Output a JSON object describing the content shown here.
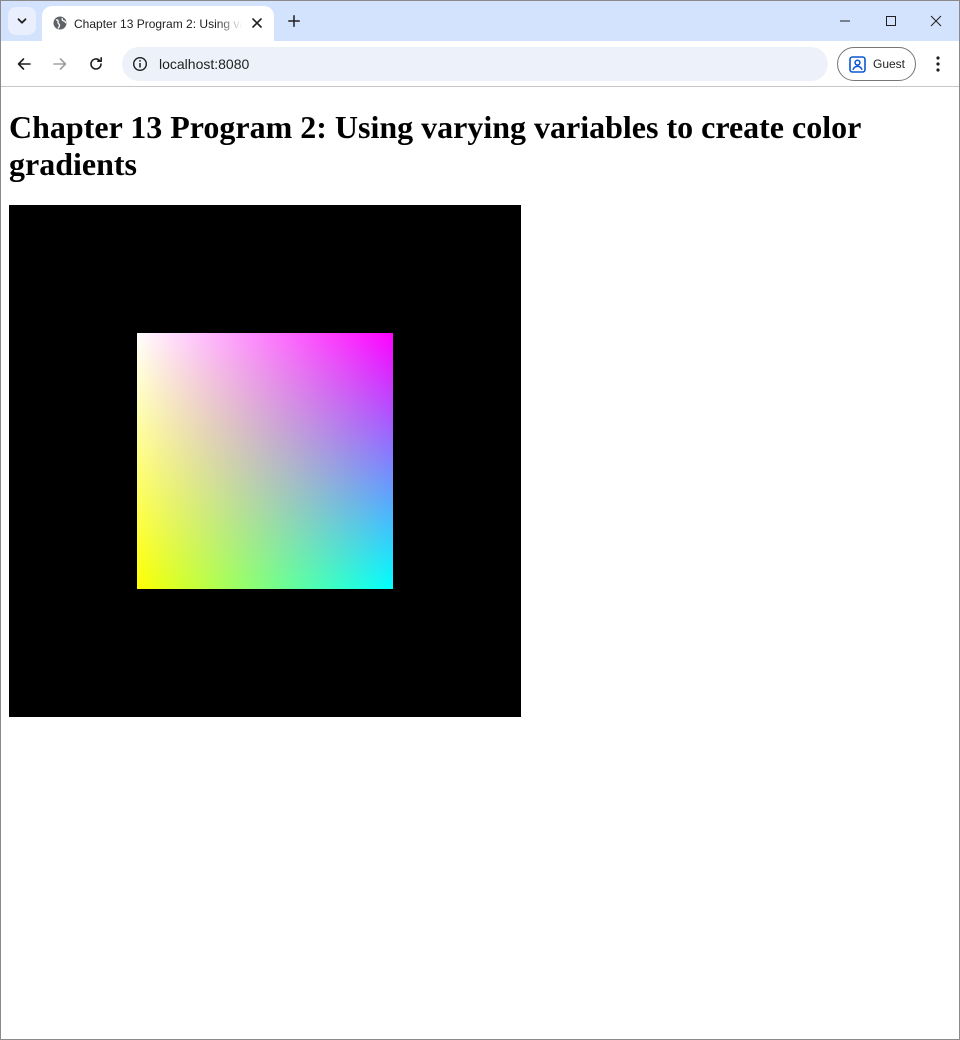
{
  "browser": {
    "tab": {
      "title": "Chapter 13 Program 2: Using varying variables to create color gradients"
    },
    "address_bar": {
      "url": "localhost:8080"
    },
    "profile": {
      "label": "Guest"
    }
  },
  "page": {
    "heading": "Chapter 13 Program 2: Using varying variables to create color gradients"
  },
  "canvas": {
    "background": "#000000",
    "quad_corner_colors": {
      "top-left": "#ffffff",
      "top-right": "#ff00ff",
      "bottom-left": "#ffff00",
      "bottom-right": "#00ffff"
    }
  },
  "colors": {
    "tabstrip": "#d3e3fd",
    "omnibox": "#edf2fa"
  }
}
